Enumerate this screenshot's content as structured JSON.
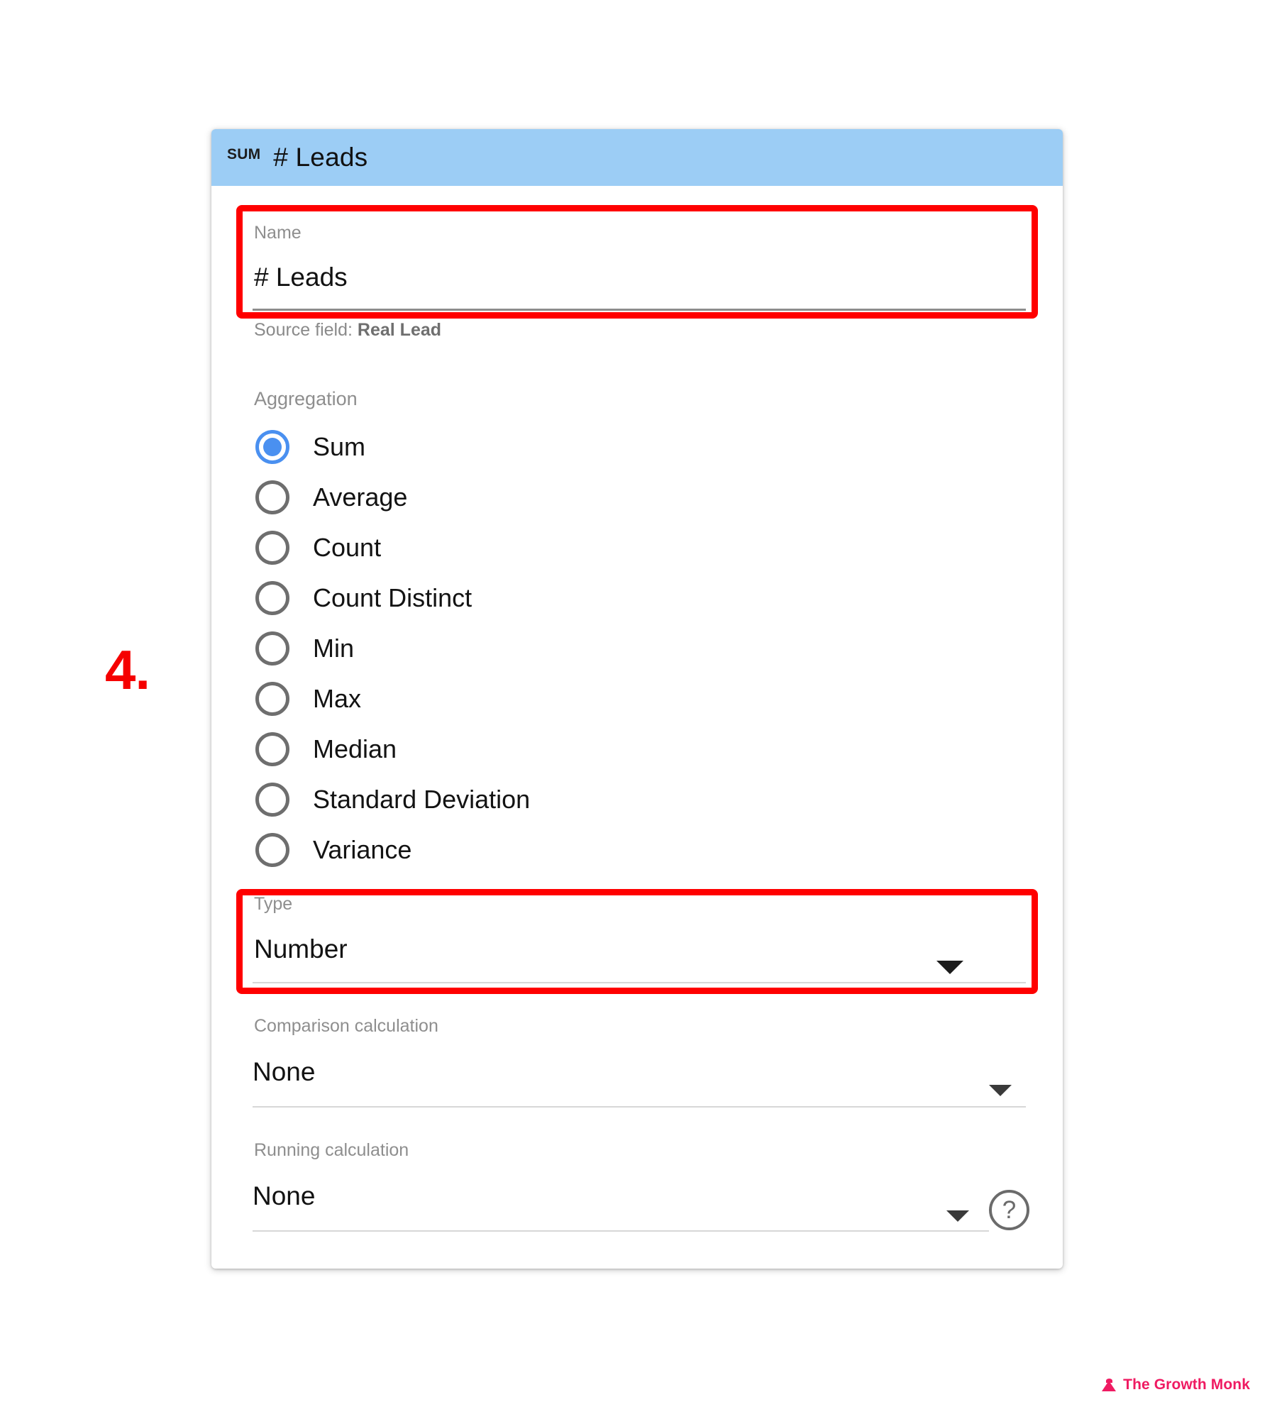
{
  "annotation": {
    "step_number": "4."
  },
  "dialog": {
    "header": {
      "aggregation_badge": "SUM",
      "title": "# Leads"
    },
    "name_field": {
      "label": "Name",
      "value": "# Leads",
      "hint_prefix": "Source field: ",
      "hint_value": "Real Lead"
    },
    "aggregation": {
      "label": "Aggregation",
      "selected": "Sum",
      "options": [
        {
          "label": "Sum",
          "selected": true
        },
        {
          "label": "Average",
          "selected": false
        },
        {
          "label": "Count",
          "selected": false
        },
        {
          "label": "Count Distinct",
          "selected": false
        },
        {
          "label": "Min",
          "selected": false
        },
        {
          "label": "Max",
          "selected": false
        },
        {
          "label": "Median",
          "selected": false
        },
        {
          "label": "Standard Deviation",
          "selected": false
        },
        {
          "label": "Variance",
          "selected": false
        }
      ]
    },
    "type_field": {
      "label": "Type",
      "value": "Number"
    },
    "comparison_calculation": {
      "label": "Comparison calculation",
      "value": "None"
    },
    "running_calculation": {
      "label": "Running calculation",
      "value": "None",
      "help_glyph": "?"
    }
  },
  "watermark": {
    "text": "The Growth Monk"
  },
  "colors": {
    "header_blue": "#9ccdf5",
    "radio_accent": "#4a90f0",
    "highlight_red": "#ff0000",
    "watermark_pink": "#ef1b62"
  }
}
